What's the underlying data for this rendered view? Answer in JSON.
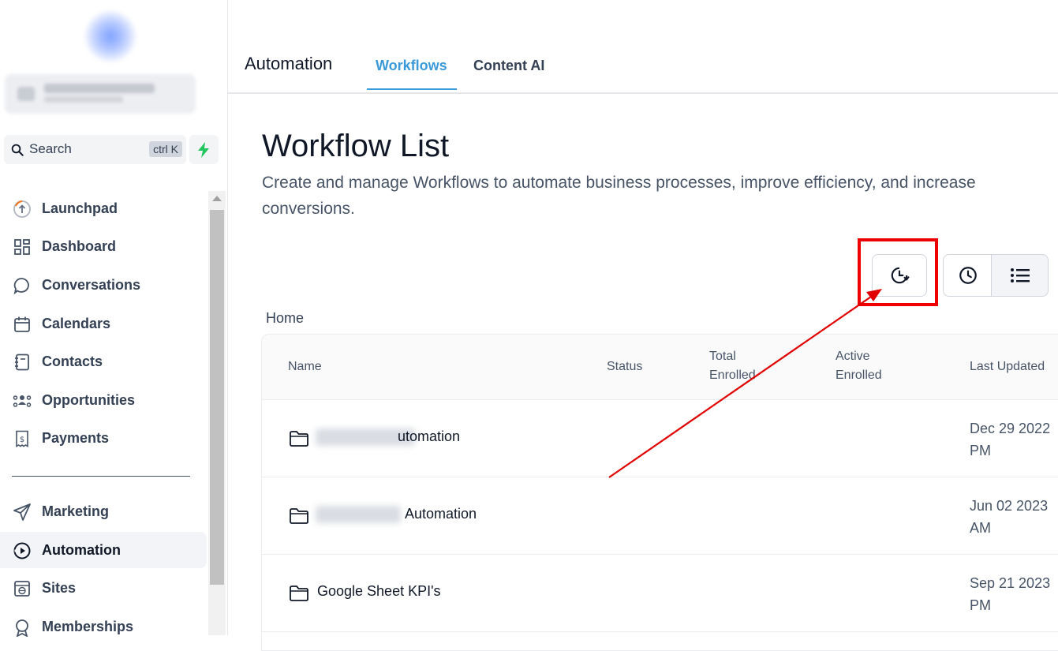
{
  "sidebar": {
    "search": {
      "label": "Search",
      "shortcut": "ctrl K"
    },
    "items": [
      {
        "label": "Launchpad",
        "icon": "launchpad-icon"
      },
      {
        "label": "Dashboard",
        "icon": "dashboard-icon"
      },
      {
        "label": "Conversations",
        "icon": "chat-bubble-icon"
      },
      {
        "label": "Calendars",
        "icon": "calendar-icon"
      },
      {
        "label": "Contacts",
        "icon": "contacts-icon"
      },
      {
        "label": "Opportunities",
        "icon": "opportunities-icon"
      },
      {
        "label": "Payments",
        "icon": "payments-icon"
      }
    ],
    "items2": [
      {
        "label": "Marketing",
        "icon": "send-icon"
      },
      {
        "label": "Automation",
        "icon": "automation-icon",
        "active": true
      },
      {
        "label": "Sites",
        "icon": "sites-icon"
      },
      {
        "label": "Memberships",
        "icon": "memberships-icon"
      }
    ]
  },
  "header": {
    "title": "Automation",
    "tabs": [
      {
        "label": "Workflows",
        "active": true
      },
      {
        "label": "Content AI"
      }
    ]
  },
  "main": {
    "title": "Workflow List",
    "description": "Create and manage Workflows to automate business processes, improve efficiency, and increase conversions.",
    "breadcrumb": "Home",
    "table": {
      "columns": [
        "Name",
        "Status",
        "Total Enrolled",
        "Active Enrolled",
        "Last Updated"
      ],
      "column_lines": {
        "total": [
          "Total",
          "Enrolled"
        ],
        "active": [
          "Active",
          "Enrolled"
        ]
      },
      "rows": [
        {
          "name": "utomation",
          "date_line1": "Dec 29 2022",
          "date_line2": "PM"
        },
        {
          "name": "Automation",
          "date_line1": "Jun 02 2023",
          "date_line2": "AM"
        },
        {
          "name": "Google Sheet KPI's",
          "date_line1": "Sep 21 2023",
          "date_line2": "PM"
        }
      ]
    }
  },
  "colors": {
    "accent": "#3b9ad9",
    "highlight": "#e00000",
    "bolt": "#22c55e"
  }
}
